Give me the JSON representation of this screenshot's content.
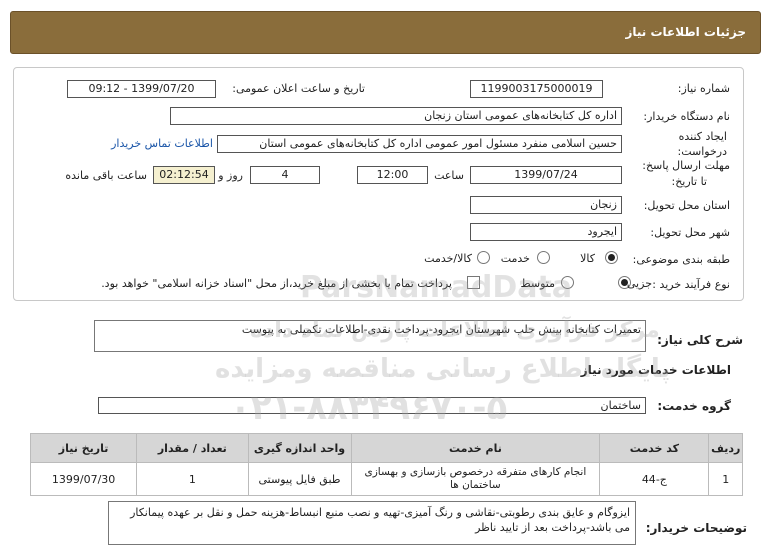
{
  "header": {
    "title": "جزئیات اطلاعات نیاز"
  },
  "fields": {
    "need_number_label": "شماره نیاز:",
    "need_number": "1199003175000019",
    "announce_label": "تاریخ و ساعت اعلان عمومی:",
    "announce_value": "1399/07/20 - 09:12",
    "buyer_label": "نام دستگاه خریدار:",
    "buyer_value": "اداره کل کتابخانه‌های عمومی استان زنجان",
    "creator_label1": "ایجاد کننده",
    "creator_label2": "درخواست:",
    "creator_value": "حسین اسلامی منفرد مسئول امور عمومی اداره کل کتابخانه‌های عمومی استان",
    "contact_link": "اطلاعات تماس خریدار",
    "deadline_label1": "مهلت ارسال پاسخ:",
    "deadline_label2": "تا تاریخ:",
    "deadline_date": "1399/07/24",
    "time_label": "ساعت",
    "deadline_time": "12:00",
    "days_value": "4",
    "days_label": "روز و",
    "remaining_value": "02:12:54",
    "remaining_label": "ساعت باقی مانده",
    "province_label": "استان محل تحویل:",
    "province_value": "زنجان",
    "city_label": "شهر محل تحویل:",
    "city_value": "ایجرود",
    "category_label": "طبقه بندی موضوعی:",
    "category_options": [
      "کالا",
      "خدمت",
      "کالا/خدمت"
    ],
    "purchase_label": "نوع فرآیند خرید :",
    "purchase_options": [
      "جزیی",
      "متوسط"
    ],
    "payment_note": "پرداخت تمام یا بخشی از مبلغ خرید،از محل \"اسناد خزانه اسلامی\" خواهد بود."
  },
  "description": {
    "label": "شرح کلی نیاز:",
    "value": "تعمیرات کتابخانه بینش حلب شهرستان ایجرود-پرداخت نقدی-اطلاعات تکمیلی به پیوست"
  },
  "services": {
    "section_title": "اطلاعات خدمات مورد نیاز",
    "group_label": "گروه خدمت:",
    "group_value": "ساختمان",
    "columns": [
      "ردیف",
      "کد خدمت",
      "نام خدمت",
      "واحد اندازه گیری",
      "تعداد / مقدار",
      "تاریخ نیاز"
    ],
    "rows": [
      {
        "row": "1",
        "code": "ج-44",
        "name": "انجام کارهای متفرقه درخصوص بازسازی و بهسازی ساختمان ها",
        "unit": "طبق فایل پیوستی",
        "qty": "1",
        "date": "1399/07/30"
      }
    ]
  },
  "buyer_notes": {
    "label": "توضیحات خریدار:",
    "value": "ایزوگام و عایق بندی رطوبتی-نقاشی و رنگ آمیزی-تهیه و نصب منبع انبساط-هزینه حمل و نقل بر عهده پیمانکار می باشد-پرداخت بعد از تایید ناظر"
  },
  "watermark": {
    "brand": "ParsNamadData",
    "line1": "مرکز فرآوری اطلاعات پارس نماد داده",
    "line2": "پایگاه اطلاع رسانی مناقصه ومزایده",
    "phone": "۰۲۱-۸۸۳۴۹۶۷۰-۵"
  },
  "colors": {
    "header_bg": "#8a6d3b",
    "link": "#1a55a8",
    "remaining_bg": "#f5f0d0"
  }
}
